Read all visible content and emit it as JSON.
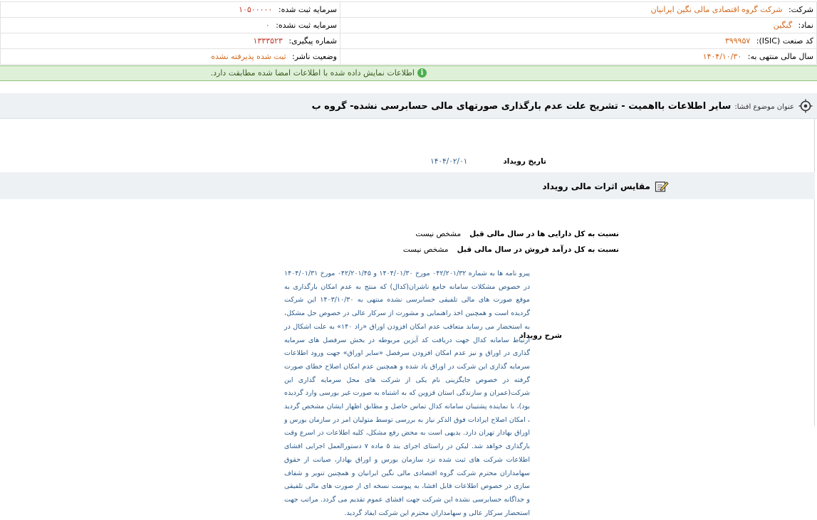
{
  "header": {
    "company_label": "شرکت:",
    "company_value": "شرکت گروه اقتصادی مالی نگین ایرانیان",
    "symbol_label": "نماد:",
    "symbol_value": "گنگین",
    "isic_label": "کد صنعت (ISIC):",
    "isic_value": "۳۹۹۹۵۷",
    "fiscal_year_label": "سال مالی منتهی به:",
    "fiscal_year_value": "۱۴۰۴/۱۰/۳۰",
    "registered_capital_label": "سرمایه ثبت شده:",
    "registered_capital_value": "۱۰۵۰۰۰۰۰",
    "unregistered_capital_label": "سرمایه ثبت نشده:",
    "unregistered_capital_value": "۰",
    "tracking_label": "شماره پیگیری:",
    "tracking_value": "۱۳۳۳۵۲۳",
    "publisher_status_label": "وضعیت ناشر:",
    "publisher_status_value": "ثبت شده پذیرفته نشده"
  },
  "notice": {
    "icon": "info-icon",
    "text": "اطلاعات نمایش داده شده با اطلاعات امضا شده مطابقت دارد."
  },
  "subject": {
    "label": "عنوان موضوع افشا:",
    "title": "سایر اطلاعات بااهمیت - تشریح علت عدم بارگذاری صورتهای مالی حسابرسی نشده- گروه ب"
  },
  "event_date": {
    "label": "تاریخ رویداد",
    "value": "۱۴۰۴/۰۲/۰۱"
  },
  "section": {
    "title": "مقایس اثرات مالی رویداد",
    "icon": "edit-icon"
  },
  "ratios": [
    {
      "label": "نسبت به کل دارایی ها در سال مالی قبل",
      "value": "مشخص نیست"
    },
    {
      "label": "نسبت به کل درآمد فروش در سال مالی قبل",
      "value": "مشخص نیست"
    }
  ],
  "description": {
    "label": "شرح رویداد",
    "text": "پیرو نامه ها به شماره ۰۴۲/۲۰۱/۳۲ مورخ ۱۴۰۴/۰۱/۳۰ و ۰۴۲/۲۰۱/۴۵ مورخ ۱۴۰۴/۰۱/۳۱ در خصوص مشکلات سامانه جامع ناشران(کدال) که منتج به عدم امکان بارگذاری به موقع صورت های مالی تلفیقی حسابرسی نشده منتهی به ۱۴۰۳/۱۰/۳۰ این شرکت گردیده است و همچنین اخذ راهنمایی و مشورت از سرکار عالی در خصوص حل مشکل، به استحضار می رساند متعاقب عدم امکان افزودن اوراق «راد ۱۴۰» به علت اشکال در ارتباط سامانه کدال جهت دریافت کد آیزین مربوطه در بخش سرفصل های سرمایه گذاری در اوراق و نیز عدم امکان افزودن سرفصل «سایر اوراق» جهت ورود اطلاعات سرمایه گذاری این شرکت در اوراق یاد شده و همچنین عدم امکان اصلاح خطای صورت گرفته در خصوص جایگزینی نام یکی از شرکت های محل سرمایه گذاری این شرکت(عمران و سازندگی استان قزوین که به اشتباه به صورت غیر بورسی وارد گردیده بود)، با نماینده پشتیبان سامانه کدال تماس حاصل و مطابق اظهار ایشان مشخص گردید ، امکان اصلاح ایرادات فوق الذکر نیاز به بررسی توسط متولیان امر در سازمان بورس و اوراق بهادار تهران دارد. بدیهی است به محض رفع مشکل، کلیه اطلاعات در اسرع وقت بارگذاری خواهد شد. لیکن در راستای اجرای بند ۵ ماده ۷ دستورالعمل اجرایی افشای اطلاعات شرکت های ثبت شده نزد سازمان بورس و اوراق بهادار، صیانت از حقوق سهامداران محترم شرکت گروه اقتصادی مالی نگین ایرانیان و همچنین تنویر و شفاف سازی در خصوص اطلاعات قابل افشا، به پیوست نسخه ای از صورت های مالی تلفیقی و جداگانه حسابرسی نشده این شرکت جهت افشای عموم تقدیم می گردد. مراتب جهت استحضار سرکار عالی و سهامداران محترم این شرکت ایفاد گردید."
  }
}
